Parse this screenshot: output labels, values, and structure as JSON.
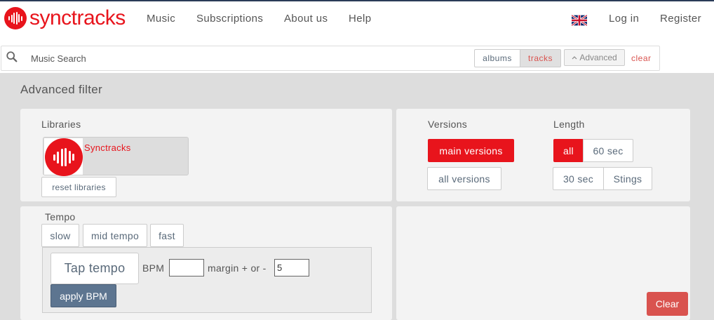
{
  "header": {
    "logo_text": "synctracks",
    "nav": [
      {
        "label": "Music"
      },
      {
        "label": "Subscriptions"
      },
      {
        "label": "About us"
      },
      {
        "label": "Help"
      }
    ],
    "login_label": "Log in",
    "register_label": "Register",
    "flag_icon": "uk-flag-icon"
  },
  "search": {
    "placeholder": "Music Search",
    "value": "",
    "albums_label": "albums",
    "tracks_label": "tracks",
    "advanced_label": "Advanced",
    "clear_label": "clear"
  },
  "filter": {
    "title": "Advanced filter",
    "libraries": {
      "label": "Libraries",
      "items": [
        {
          "name": "Synctracks"
        }
      ],
      "reset_label": "reset libraries"
    },
    "versions": {
      "label": "Versions",
      "main_label": "main versions",
      "all_label": "all versions",
      "selected": "main versions"
    },
    "length": {
      "label": "Length",
      "all_label": "all",
      "sec60_label": "60 sec",
      "sec30_label": "30 sec",
      "stings_label": "Stings",
      "selected": "all"
    },
    "tempo": {
      "label": "Tempo",
      "slow_label": "slow",
      "mid_label": "mid tempo",
      "fast_label": "fast",
      "tap_label": "Tap tempo",
      "bpm_label": "BPM",
      "bpm_value": "",
      "margin_label": "margin + or -",
      "margin_value": "5",
      "apply_label": "apply BPM"
    },
    "clear_label": "Clear"
  },
  "colors": {
    "brand_red": "#e8141c",
    "clear_red": "#d9534f",
    "apply_blue": "#5d7590"
  }
}
